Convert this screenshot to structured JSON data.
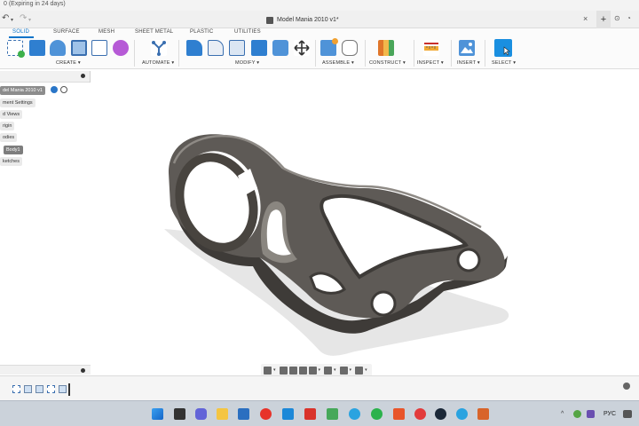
{
  "window": {
    "expiry_text": "0 (Expiring in 24 days)",
    "doc_title": "Model Mania 2010 v1*",
    "close_glyph": "×",
    "plus_glyph": "+"
  },
  "ribbon": {
    "tabs": [
      {
        "label": "SOLID",
        "active": true
      },
      {
        "label": "SURFACE",
        "active": false
      },
      {
        "label": "MESH",
        "active": false
      },
      {
        "label": "SHEET METAL",
        "active": false
      },
      {
        "label": "PLASTIC",
        "active": false
      },
      {
        "label": "UTILITIES",
        "active": false
      }
    ],
    "groups": [
      "CREATE ▾",
      "AUTOMATE ▾",
      "MODIFY ▾",
      "ASSEMBLE ▾",
      "CONSTRUCT ▾",
      "INSPECT ▾",
      "INSERT ▾",
      "SELECT ▾"
    ]
  },
  "browser": {
    "nodes": [
      {
        "label": "del Mania 2010 v1",
        "kind": "root"
      },
      {
        "label": "ment Settings",
        "kind": "folder"
      },
      {
        "label": "d Views",
        "kind": "folder"
      },
      {
        "label": "rigin",
        "kind": "folder"
      },
      {
        "label": "odies",
        "kind": "folder"
      },
      {
        "label": "Body1",
        "kind": "body"
      },
      {
        "label": "ketches",
        "kind": "folder"
      }
    ]
  },
  "taskbar": {
    "tray_lang": "РУС"
  },
  "colors": {
    "accent": "#0a74c9",
    "part_dark": "#4a4643",
    "part_mid": "#6e6a66",
    "part_light": "#8d8984",
    "shadow": "#e3e3e3"
  }
}
